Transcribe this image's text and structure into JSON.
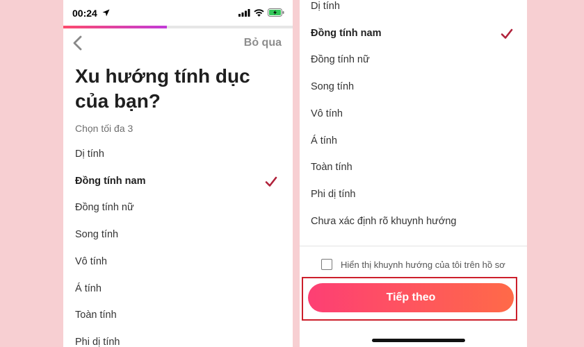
{
  "status_bar": {
    "time": "00:24",
    "icons": [
      "location-arrow-icon",
      "signal-icon",
      "wifi-icon",
      "battery-charging-icon"
    ]
  },
  "progress": {
    "fraction": 0.45,
    "colors": [
      "#fd4a6c",
      "#c23bd8"
    ]
  },
  "header": {
    "back_icon": "chevron-left-icon",
    "skip_label": "Bỏ qua"
  },
  "question": {
    "title": "Xu hướng tính dục của bạn?",
    "subtitle": "Chọn tối đa 3"
  },
  "left_list": [
    {
      "label": "Dị tính",
      "selected": false
    },
    {
      "label": "Đồng tính nam",
      "selected": true
    },
    {
      "label": "Đồng tính nữ",
      "selected": false
    },
    {
      "label": "Song tính",
      "selected": false
    },
    {
      "label": "Vô tính",
      "selected": false
    },
    {
      "label": "Á tính",
      "selected": false
    },
    {
      "label": "Toàn tính",
      "selected": false
    },
    {
      "label": "Phi dị tính",
      "selected": false
    }
  ],
  "right_list": [
    {
      "label": "Dị tính",
      "selected": false
    },
    {
      "label": "Đồng tính nam",
      "selected": true
    },
    {
      "label": "Đồng tính nữ",
      "selected": false
    },
    {
      "label": "Song tính",
      "selected": false
    },
    {
      "label": "Vô tính",
      "selected": false
    },
    {
      "label": "Á tính",
      "selected": false
    },
    {
      "label": "Toàn tính",
      "selected": false
    },
    {
      "label": "Phi dị tính",
      "selected": false
    },
    {
      "label": "Chưa xác định rõ khuynh hướng",
      "selected": false
    }
  ],
  "footer": {
    "show_on_profile_label": "Hiển thị khuynh hướng của tôi trên hồ sơ",
    "show_on_profile_checked": false,
    "next_label": "Tiếp theo"
  },
  "colors": {
    "background": "#f7cfd2",
    "check": "#b0213a",
    "highlight_outline": "#cc1f2b",
    "button_gradient": [
      "#fd3f74",
      "#ff6a48"
    ]
  }
}
